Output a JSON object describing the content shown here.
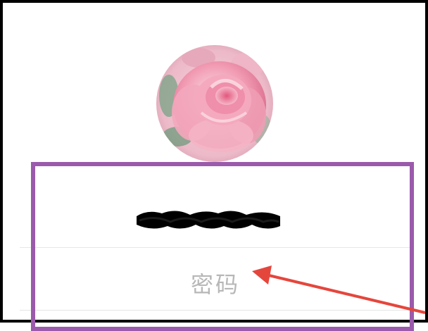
{
  "login": {
    "avatar_icon": "rose-avatar",
    "username_icon": "redacted-username",
    "password_placeholder": "密码"
  },
  "annotation": {
    "highlight_color": "#9b5aac",
    "arrow_color": "#e5463c",
    "arrow_icon": "red-arrow-icon"
  }
}
